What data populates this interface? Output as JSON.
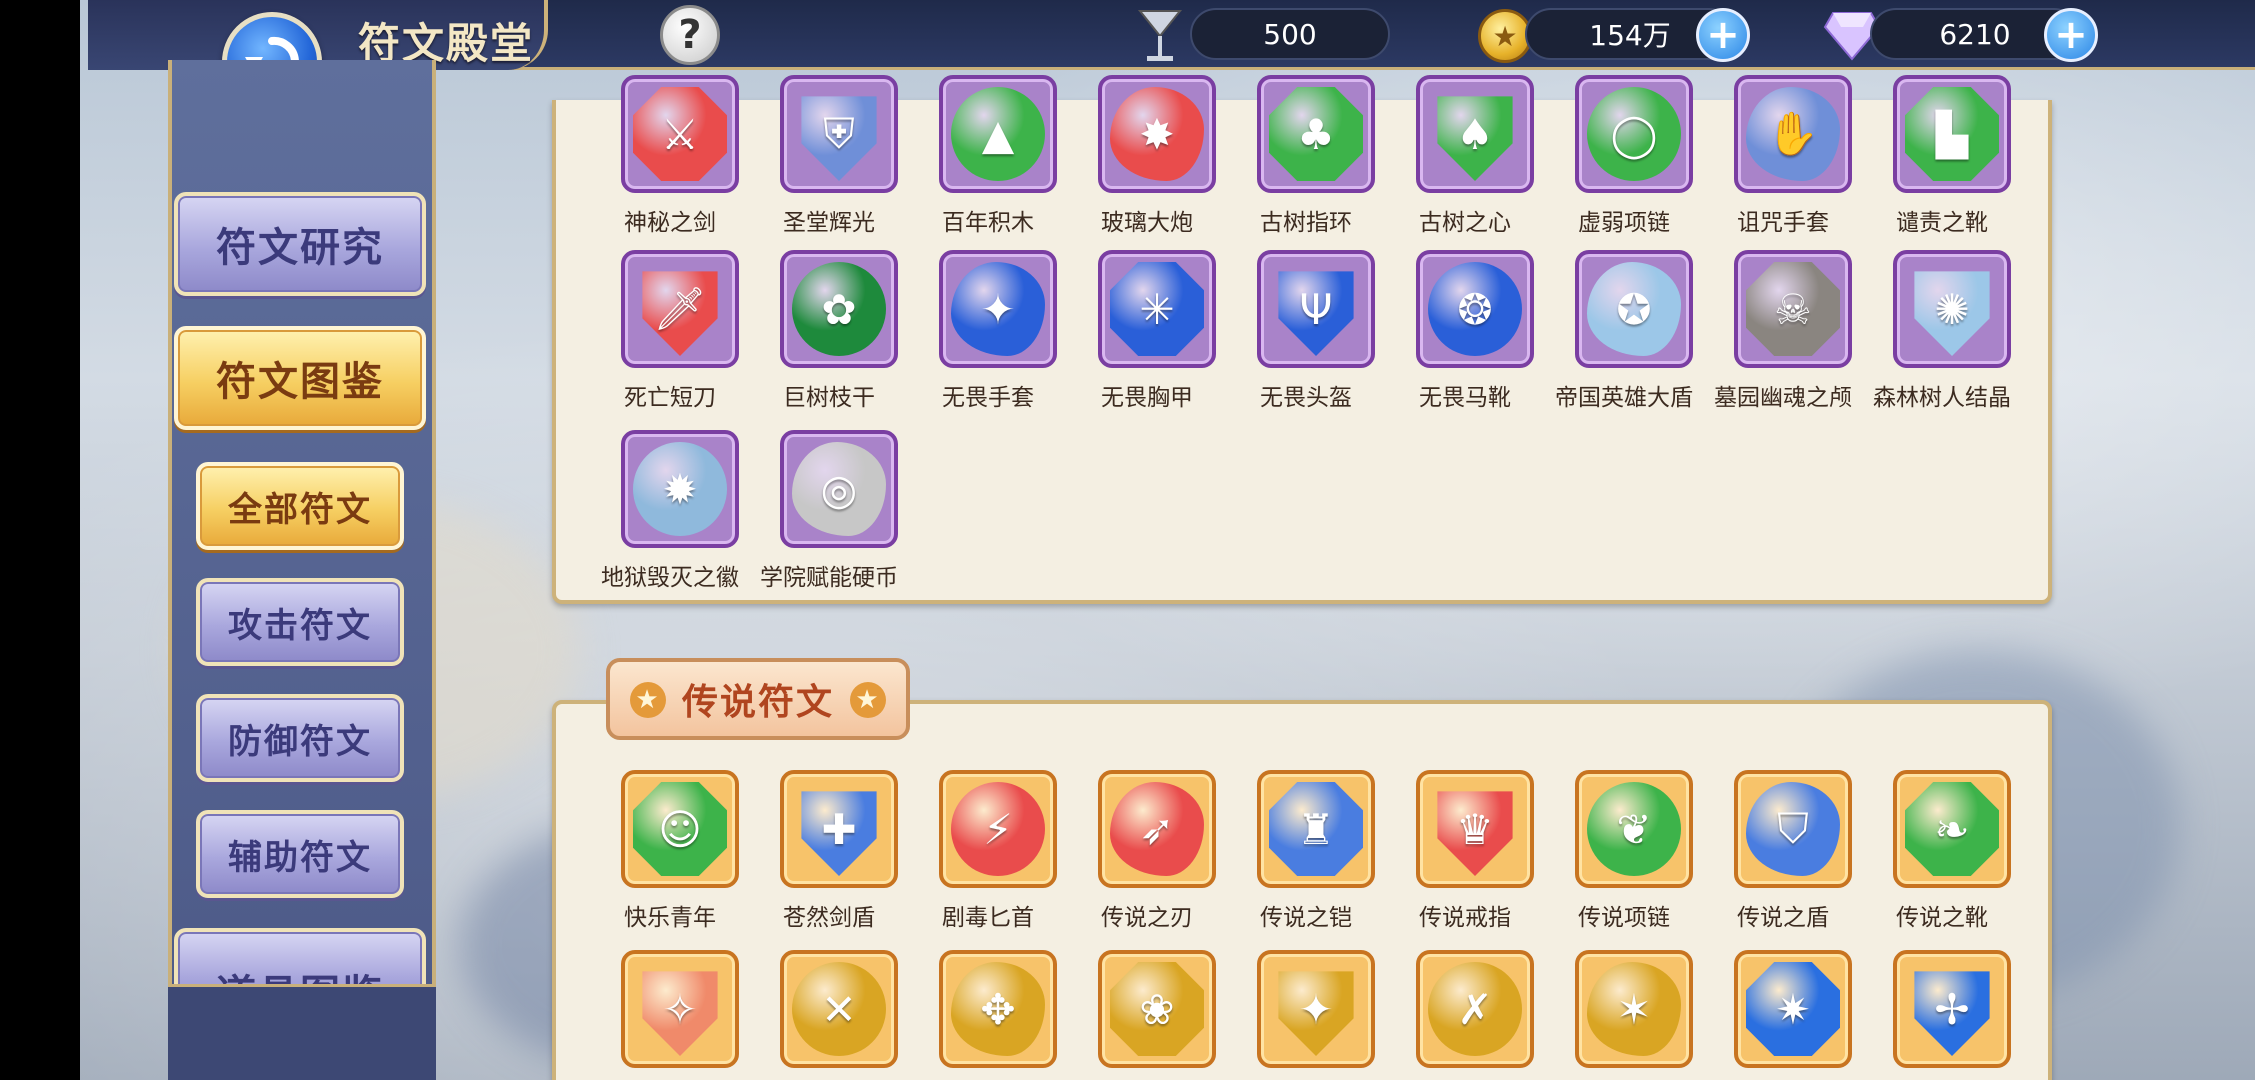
{
  "header": {
    "title": "符文殿堂",
    "help_label": "?",
    "resources": {
      "cocktail": "500",
      "gold": "154万",
      "diamond": "6210"
    },
    "plus": "+"
  },
  "sidebar": {
    "items": [
      {
        "label": "符文研究"
      },
      {
        "label": "符文图鉴"
      },
      {
        "label": "全部符文"
      },
      {
        "label": "攻击符文"
      },
      {
        "label": "防御符文"
      },
      {
        "label": "辅助符文"
      },
      {
        "label": "道具图鉴"
      }
    ]
  },
  "epic_runes": {
    "rows": [
      [
        {
          "name": "神秘之剑",
          "gem": "#e94c4c",
          "glyph": "⚔"
        },
        {
          "name": "圣堂辉光",
          "gem": "#6f8fd8",
          "glyph": "⛨"
        },
        {
          "name": "百年积木",
          "gem": "#3db34a",
          "glyph": "▲"
        },
        {
          "name": "玻璃大炮",
          "gem": "#e94c4c",
          "glyph": "✸"
        },
        {
          "name": "古树指环",
          "gem": "#3db34a",
          "glyph": "♣"
        },
        {
          "name": "古树之心",
          "gem": "#3db34a",
          "glyph": "♠"
        },
        {
          "name": "虚弱项链",
          "gem": "#3db34a",
          "glyph": "◯"
        },
        {
          "name": "诅咒手套",
          "gem": "#6f8fd8",
          "glyph": "✋"
        },
        {
          "name": "谴责之靴",
          "gem": "#3db34a",
          "glyph": "▙"
        }
      ],
      [
        {
          "name": "死亡短刀",
          "gem": "#e94c4c",
          "glyph": "🗡"
        },
        {
          "name": "巨树枝干",
          "gem": "#1e8a3c",
          "glyph": "✿"
        },
        {
          "name": "无畏手套",
          "gem": "#2a5fd8",
          "glyph": "✦"
        },
        {
          "name": "无畏胸甲",
          "gem": "#2a5fd8",
          "glyph": "✳"
        },
        {
          "name": "无畏头盔",
          "gem": "#2a5fd8",
          "glyph": "Ψ"
        },
        {
          "name": "无畏马靴",
          "gem": "#2a5fd8",
          "glyph": "❂"
        },
        {
          "name": "帝国英雄大盾",
          "gem": "#9cc7e8",
          "glyph": "✪"
        },
        {
          "name": "墓园幽魂之颅",
          "gem": "#8a8580",
          "glyph": "☠"
        },
        {
          "name": "森林树人结晶",
          "gem": "#9cc7e8",
          "glyph": "✺"
        }
      ],
      [
        {
          "name": "地狱毁灭之徽",
          "gem": "#8fb9dc",
          "glyph": "✹"
        },
        {
          "name": "学院赋能硬币",
          "gem": "#c7c7c7",
          "glyph": "◎"
        }
      ]
    ]
  },
  "legend_section": {
    "title": "传说符文",
    "star": "★",
    "rows": [
      [
        {
          "name": "快乐青年",
          "gem": "#3db34a",
          "glyph": "☺"
        },
        {
          "name": "苍然剑盾",
          "gem": "#4a7de0",
          "glyph": "✚"
        },
        {
          "name": "剧毒匕首",
          "gem": "#e94c4c",
          "glyph": "⚡"
        },
        {
          "name": "传说之刃",
          "gem": "#e94c4c",
          "glyph": "➶"
        },
        {
          "name": "传说之铠",
          "gem": "#4a7de0",
          "glyph": "♜"
        },
        {
          "name": "传说戒指",
          "gem": "#e94c4c",
          "glyph": "♛"
        },
        {
          "name": "传说项链",
          "gem": "#3db34a",
          "glyph": "❦"
        },
        {
          "name": "传说之盾",
          "gem": "#4a7de0",
          "glyph": "⛉"
        },
        {
          "name": "传说之靴",
          "gem": "#3db34a",
          "glyph": "❧"
        }
      ],
      [
        {
          "name": "",
          "gem": "#f08a6a",
          "glyph": "✧"
        },
        {
          "name": "",
          "gem": "#d9a523",
          "glyph": "✕"
        },
        {
          "name": "",
          "gem": "#d9a523",
          "glyph": "✥"
        },
        {
          "name": "",
          "gem": "#d9a523",
          "glyph": "❀"
        },
        {
          "name": "",
          "gem": "#d9a523",
          "glyph": "✦"
        },
        {
          "name": "",
          "gem": "#d9a523",
          "glyph": "✗"
        },
        {
          "name": "",
          "gem": "#d9a523",
          "glyph": "✶"
        },
        {
          "name": "",
          "gem": "#2a6fe0",
          "glyph": "✷"
        },
        {
          "name": "",
          "gem": "#2a6fe0",
          "glyph": "✢"
        }
      ]
    ]
  }
}
